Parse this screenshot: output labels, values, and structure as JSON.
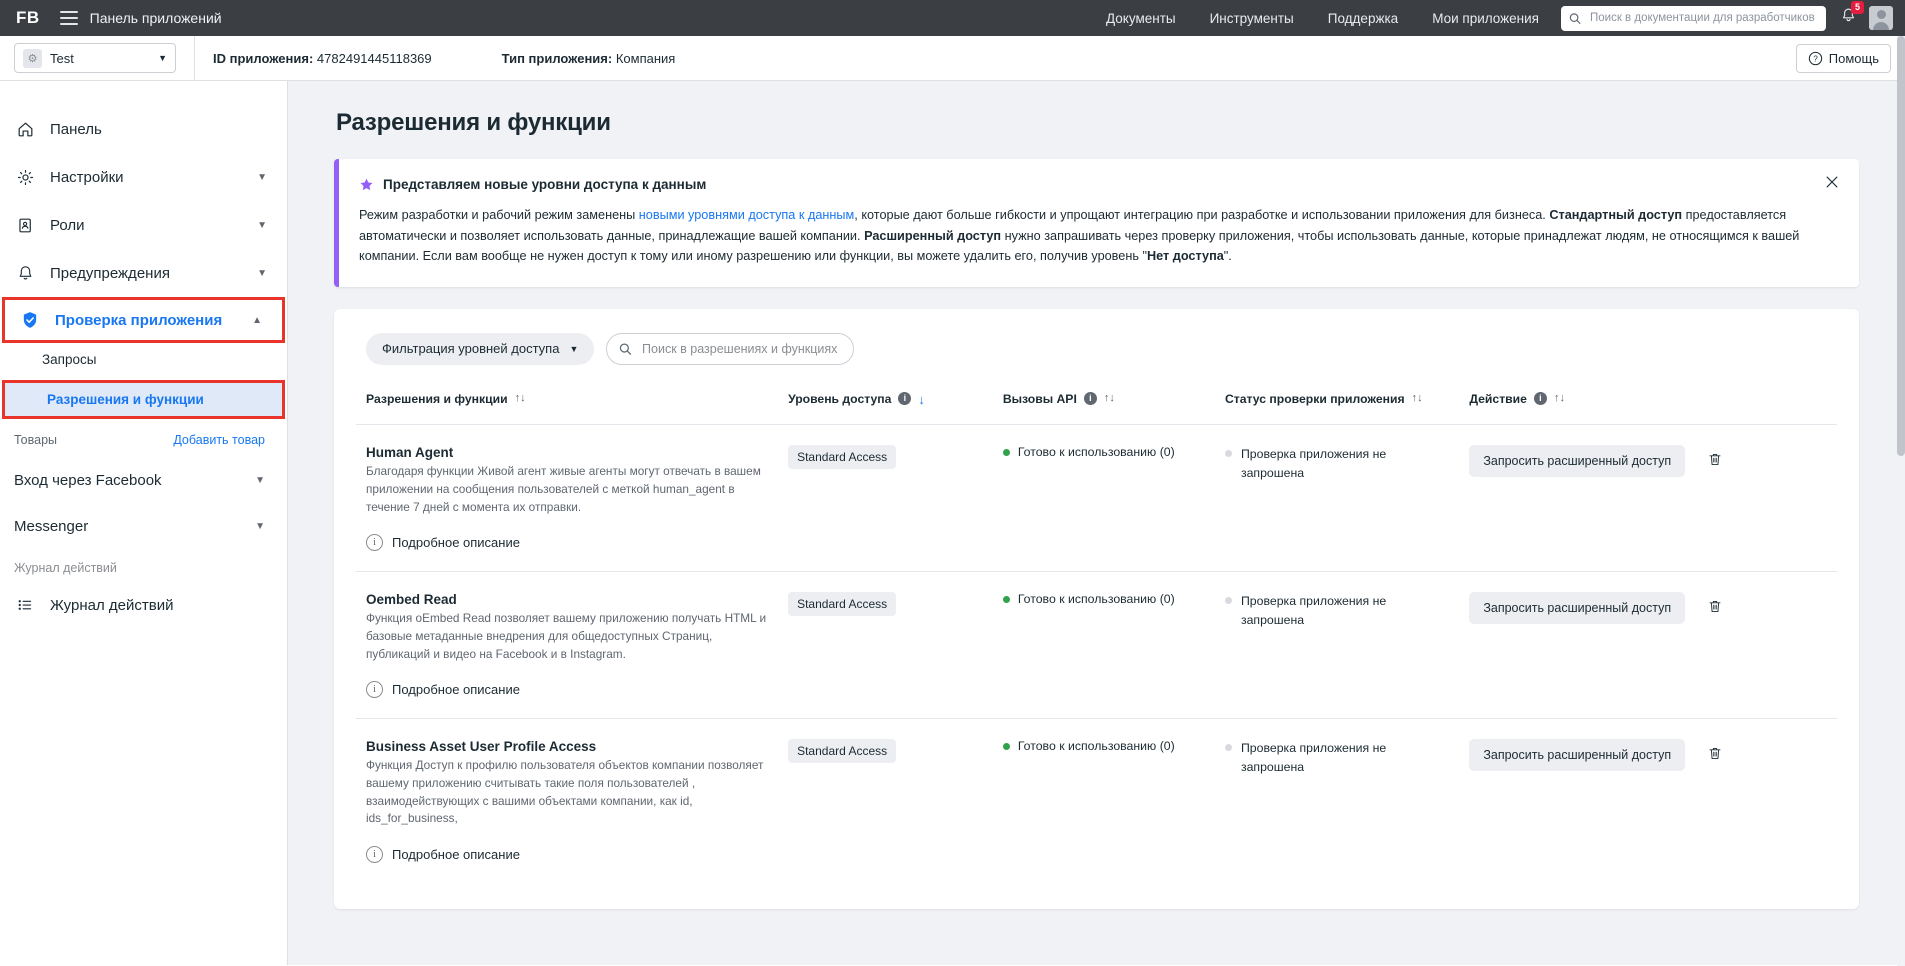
{
  "topbar": {
    "logo": "FB",
    "title": "Панель приложений",
    "nav": [
      {
        "label": "Документы"
      },
      {
        "label": "Инструменты"
      },
      {
        "label": "Поддержка"
      },
      {
        "label": "Мои приложения"
      }
    ],
    "search_placeholder": "Поиск в документации для разработчиков",
    "notification_count": "5"
  },
  "subheader": {
    "app_name": "Test",
    "app_id_label": "ID приложения:",
    "app_id_value": "4782491445118369",
    "app_type_label": "Тип приложения:",
    "app_type_value": "Компания",
    "help_label": "Помощь"
  },
  "sidebar": {
    "items": [
      {
        "label": "Панель",
        "icon": "home-icon",
        "expandable": false
      },
      {
        "label": "Настройки",
        "icon": "gear-icon",
        "expandable": true
      },
      {
        "label": "Роли",
        "icon": "roles-icon",
        "expandable": true
      },
      {
        "label": "Предупреждения",
        "icon": "bell-icon",
        "expandable": true
      },
      {
        "label": "Проверка приложения",
        "icon": "shield-check-icon",
        "expandable": true,
        "active": true
      }
    ],
    "subitems": [
      {
        "label": "Запросы",
        "selected": false
      },
      {
        "label": "Разрешения и функции",
        "selected": true
      }
    ],
    "products_label": "Товары",
    "add_product_label": "Добавить товар",
    "products": [
      {
        "label": "Вход через Facebook"
      },
      {
        "label": "Messenger"
      }
    ],
    "activity_section_label": "Журнал действий",
    "activity_item_label": "Журнал действий"
  },
  "main": {
    "page_title": "Разрешения и функции",
    "banner": {
      "title": "Представляем новые уровни доступа к данным",
      "p1_a": "Режим разработки и рабочий режим заменены ",
      "p1_link": "новыми уровнями доступа к данным",
      "p1_b": ", которые дают больше гибкости и упрощают интеграцию при разработке и использовании приложения для бизнеса. ",
      "p1_bold1": "Стандартный доступ",
      "p2_a": " предоставляется автоматически и позволяет использовать данные, принадлежащие вашей компании. ",
      "p2_bold": "Расширенный доступ",
      "p2_b": " нужно запрашивать через проверку приложения, чтобы использовать данные, которые принадлежат людям, не относящимся к вашей компании. Если вам вообще не нужен доступ к тому или иному разрешению или функции, вы можете удалить его, получив уровень \"",
      "p2_bold2": "Нет доступа",
      "p2_c": "\"."
    },
    "toolbar": {
      "filter_label": "Фильтрация уровней доступа",
      "search_placeholder": "Поиск в разрешениях и функциях"
    },
    "table": {
      "columns": [
        {
          "label": "Разрешения и функции",
          "info": false,
          "sort": "↑↓"
        },
        {
          "label": "Уровень доступа",
          "info": true,
          "sort": "↓",
          "sort_active": true
        },
        {
          "label": "Вызовы API",
          "info": true,
          "sort": "↑↓"
        },
        {
          "label": "Статус проверки приложения",
          "info": false,
          "sort": "↑↓"
        },
        {
          "label": "Действие",
          "info": true,
          "sort": "↑↓"
        }
      ],
      "detail_link_label": "Подробное описание",
      "rows": [
        {
          "name": "Human Agent",
          "description": "Благодаря функции Живой агент живые агенты могут отвечать в вашем приложении на сообщения пользователей с меткой human_agent в течение 7 дней с момента их отправки.",
          "access_level": "Standard Access",
          "api_calls": "Готово к использованию (0)",
          "review_status": "Проверка приложения не запрошена",
          "action_label": "Запросить расширенный доступ"
        },
        {
          "name": "Oembed Read",
          "description": "Функция oEmbed Read позволяет вашему приложению получать HTML и базовые метаданные внедрения для общедоступных Страниц, публикаций и видео на Facebook и в Instagram.",
          "access_level": "Standard Access",
          "api_calls": "Готово к использованию (0)",
          "review_status": "Проверка приложения не запрошена",
          "action_label": "Запросить расширенный доступ"
        },
        {
          "name": "Business Asset User Profile Access",
          "description": "Функция Доступ к профилю пользователя объектов компании позволяет вашему приложению считывать такие поля пользователей , взаимодействующих с вашими объектами компании, как id, ids_for_business,",
          "access_level": "Standard Access",
          "api_calls": "Готово к использованию (0)",
          "review_status": "Проверка приложения не запрошена",
          "action_label": "Запросить расширенный доступ"
        }
      ]
    }
  },
  "colors": {
    "brand_blue": "#1877f2",
    "highlight_red": "#e8342a",
    "banner_accent": "#9360f7",
    "status_green": "#31a24c",
    "topbar_bg": "#3b3e43"
  }
}
